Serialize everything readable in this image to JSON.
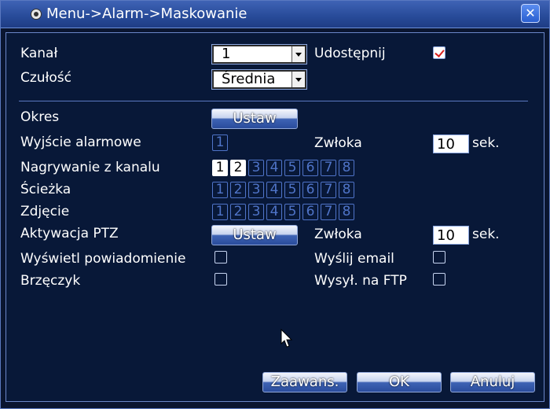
{
  "window": {
    "title": "Menu->Alarm->Maskowanie",
    "close_label": "✕"
  },
  "form": {
    "kanal_label": "Kanał",
    "kanal_value": "1",
    "udostepnij_label": "Udostępnij",
    "udostepnij_checked": true,
    "czulosc_label": "Czułość",
    "czulosc_value": "Średnia",
    "okres_label": "Okres",
    "okres_button": "Ustaw",
    "wyjscie_label": "Wyjście alarmowe",
    "wyjscie_channels": [
      "1"
    ],
    "zwloka1_label": "Zwłoka",
    "zwloka1_value": "10",
    "zwloka1_unit": "sek.",
    "nagrywanie_label": "Nagrywanie z kanalu",
    "nagrywanie_channels": [
      "1",
      "2",
      "3",
      "4",
      "5",
      "6",
      "7",
      "8"
    ],
    "nagrywanie_active": [
      "1",
      "2"
    ],
    "sciezka_label": "Ścieżka",
    "sciezka_channels": [
      "1",
      "2",
      "3",
      "4",
      "5",
      "6",
      "7",
      "8"
    ],
    "zdjecie_label": "Zdjęcie",
    "zdjecie_channels": [
      "1",
      "2",
      "3",
      "4",
      "5",
      "6",
      "7",
      "8"
    ],
    "ptz_label": "Aktywacja PTZ",
    "ptz_button": "Ustaw",
    "zwloka2_label": "Zwłoka",
    "zwloka2_value": "10",
    "zwloka2_unit": "sek.",
    "powiadomienie_label": "Wyświetl powiadomienie",
    "powiadomienie_checked": false,
    "email_label": "Wyślij email",
    "email_checked": false,
    "brzeczyk_label": "Brzęczyk",
    "brzeczyk_checked": false,
    "ftp_label": "Wysył. na FTP",
    "ftp_checked": false
  },
  "buttons": {
    "advanced": "Zaawans.",
    "ok": "OK",
    "cancel": "Anuluj"
  },
  "icons": {
    "title_icon": "eye-icon",
    "close_icon": "close-icon",
    "cursor_icon": "mouse-pointer-icon"
  }
}
